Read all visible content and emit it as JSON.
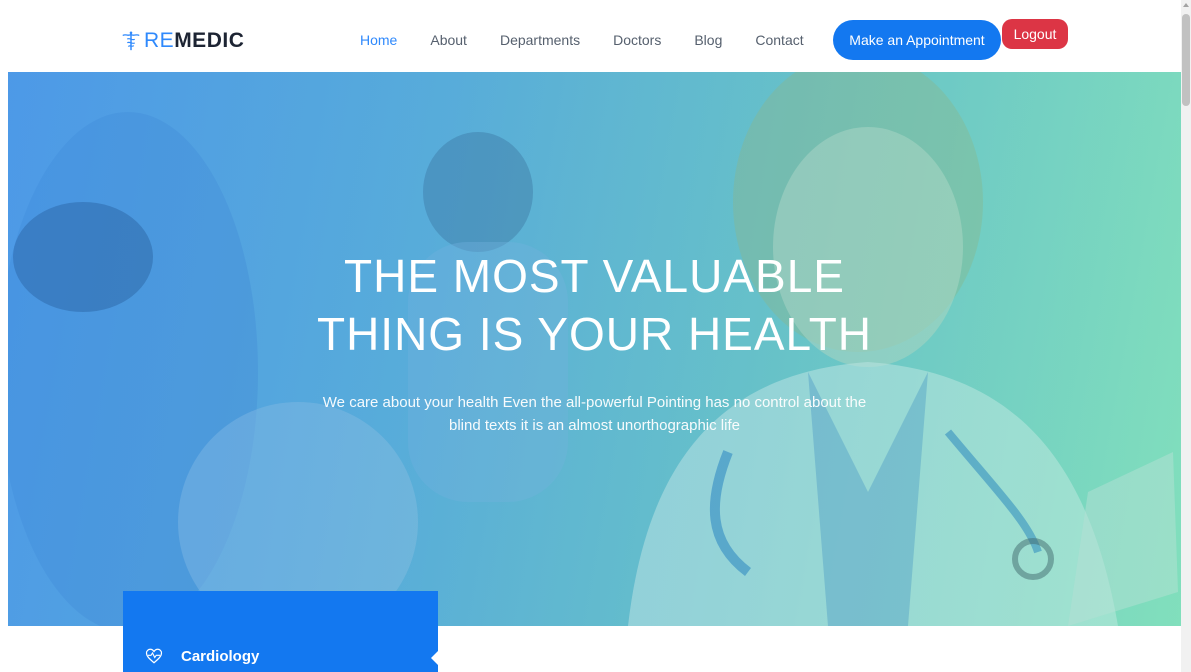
{
  "brand": {
    "prefix": "RE",
    "name": "MEDIC"
  },
  "nav": {
    "items": [
      {
        "label": "Home",
        "active": true
      },
      {
        "label": "About",
        "active": false
      },
      {
        "label": "Departments",
        "active": false
      },
      {
        "label": "Doctors",
        "active": false
      },
      {
        "label": "Blog",
        "active": false
      },
      {
        "label": "Contact",
        "active": false
      }
    ],
    "appointment_label": "Make an Appointment",
    "logout_label": "Logout"
  },
  "hero": {
    "title_line1": "THE MOST VALUABLE",
    "title_line2": "THING IS YOUR HEALTH",
    "subtitle_line1": "We care about your health Even the all-powerful Pointing has no control about the",
    "subtitle_line2": "blind texts it is an almost unorthographic life"
  },
  "departments": {
    "items": [
      {
        "label": "Cardiology",
        "icon": "heart-pulse-icon"
      }
    ]
  },
  "colors": {
    "accent": "#2f89fc",
    "primary_button": "#1378f0",
    "logout_button": "#dc3545",
    "nav_text": "#56606e",
    "brand_dark": "#1d2433"
  }
}
